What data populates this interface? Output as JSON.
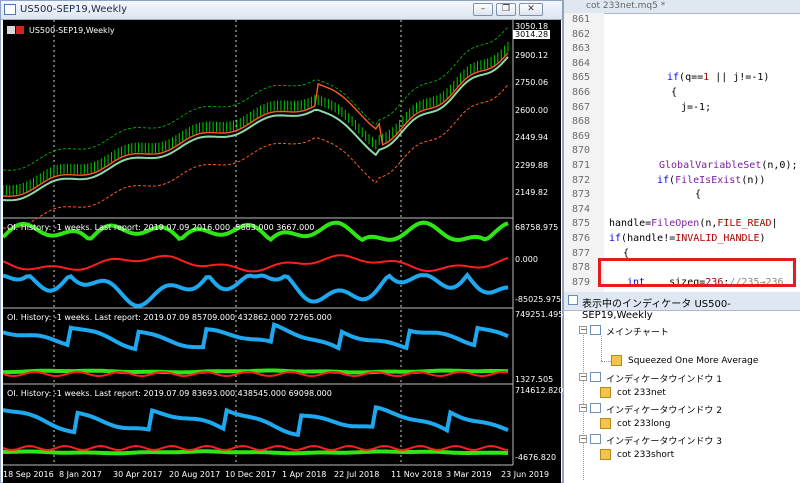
{
  "chart_window": {
    "title": "US500-SEP19,Weekly",
    "inner_title": "US500-SEP19,Weekly",
    "price_labels": [
      "3050.18",
      "2900.12",
      "2750.06",
      "2600.00",
      "2449.94",
      "2299.88",
      "2149.82"
    ],
    "current_price": "3014.28",
    "panels": [
      {
        "label": "OI. History: -1 weeks. Last report: 2019.07.09   2016.000 -5683.000 3667.000",
        "scale": [
          "68758.975",
          "0.000",
          "-85025.975"
        ]
      },
      {
        "label": "OI. History: -1 weeks. Last report: 2019.07.09   85709.000 432862.000 72765.000",
        "scale": [
          "749251.495",
          "1327.505"
        ]
      },
      {
        "label": "OI. History: -1 weeks. Last report: 2019.07.09   83693.000 438545.000 69098.000",
        "scale": [
          "714612.820",
          "-4676.820"
        ]
      }
    ],
    "x_labels": [
      "18 Sep 2016",
      "8 Jan 2017",
      "30 Apr 2017",
      "20 Aug 2017",
      "10 Dec 2017",
      "1 Apr 2018",
      "22 Jul 2018",
      "11 Nov 2018",
      "3 Mar 2019",
      "23 Jun 2019"
    ],
    "colors": {
      "bull": "#00c800",
      "line_green": "#8fd9a8",
      "line_orange": "#ff5a1e",
      "cyan": "#1ea8f0",
      "green": "#2ee614",
      "red": "#ff1e1e"
    }
  },
  "editor": {
    "tab_title": "cot 233net.mq5 *",
    "lines": [
      {
        "n": "861",
        "code": ""
      },
      {
        "n": "862",
        "code": ""
      },
      {
        "n": "863",
        "code": ""
      },
      {
        "n": "864",
        "code": ""
      },
      {
        "n": "865",
        "code": "if(q==1 || j!=-1)"
      },
      {
        "n": "866",
        "code": "{"
      },
      {
        "n": "867",
        "code": "j=-1;"
      },
      {
        "n": "868",
        "code": ""
      },
      {
        "n": "869",
        "code": ""
      },
      {
        "n": "870",
        "code": ""
      },
      {
        "n": "871",
        "code": "GlobalVariableSet(n,0);"
      },
      {
        "n": "872",
        "code": "if(FileIsExist(n))"
      },
      {
        "n": "873",
        "code": "{"
      },
      {
        "n": "874",
        "code": ""
      },
      {
        "n": "875",
        "code": "handle=FileOpen(n,FILE_READ|"
      },
      {
        "n": "876",
        "code": "if(handle!=INVALID_HANDLE)"
      },
      {
        "n": "877",
        "code": "{"
      },
      {
        "n": "878",
        "code": ""
      },
      {
        "n": "879",
        "code": "int    sizeg=236;//235→236"
      }
    ]
  },
  "navigator": {
    "title": "表示中のインディケータ US500-SEP19,Weekly",
    "items": [
      {
        "label": "メインチャート"
      },
      {
        "label": "Squeezed One More Average"
      },
      {
        "label": "インディケータウインドウ 1"
      },
      {
        "label": "cot 233net"
      },
      {
        "label": "インディケータウインドウ 2"
      },
      {
        "label": "cot 233long"
      },
      {
        "label": "インディケータウインドウ 3"
      },
      {
        "label": "cot 233short"
      }
    ]
  }
}
